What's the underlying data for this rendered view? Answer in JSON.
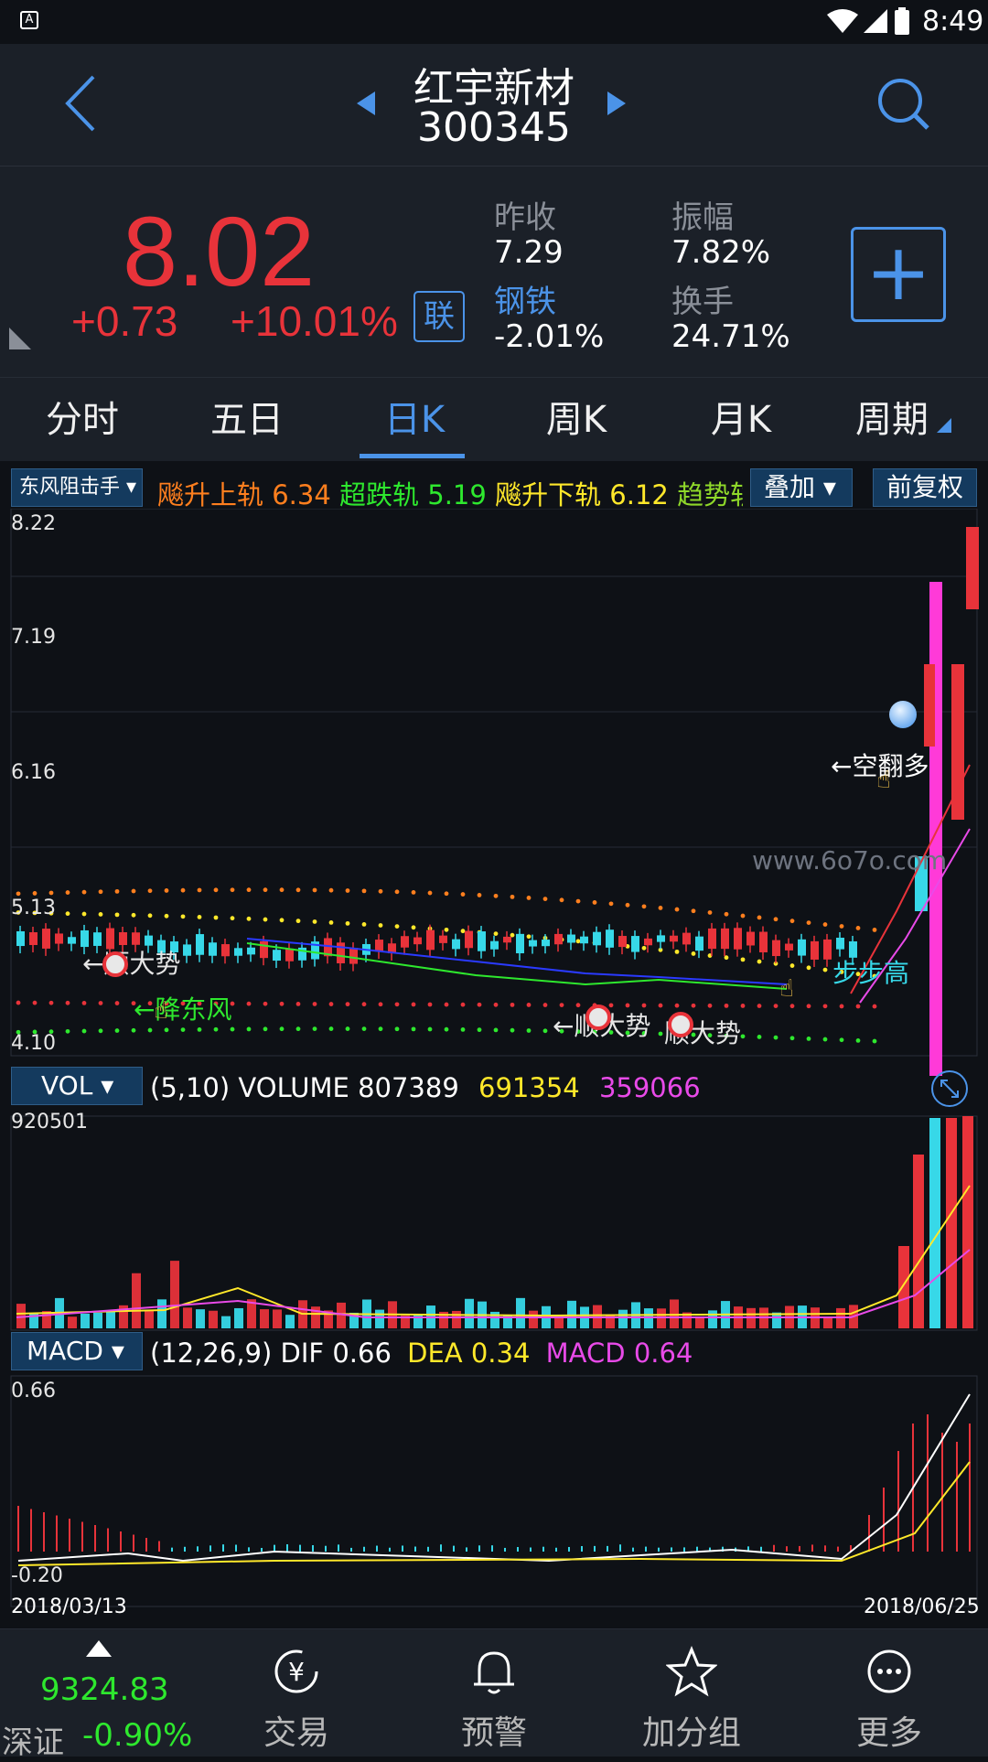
{
  "status_bar": {
    "time": "8:49"
  },
  "header": {
    "stock_name": "红宇新材",
    "stock_code": "300345"
  },
  "quote": {
    "price": "8.02",
    "change": "+0.73",
    "change_pct": "+10.01%",
    "link_label": "联",
    "prev_close_label": "昨收",
    "prev_close": "7.29",
    "sector_label": "钢铁",
    "sector_change": "-2.01%",
    "amplitude_label": "振幅",
    "amplitude": "7.82%",
    "turnover_label": "换手",
    "turnover": "24.71%",
    "add_label": "+"
  },
  "tabs": [
    {
      "label": "分时"
    },
    {
      "label": "五日"
    },
    {
      "label": "日K",
      "active": true
    },
    {
      "label": "周K"
    },
    {
      "label": "月K"
    },
    {
      "label": "周期"
    }
  ],
  "main_indicator": {
    "selector": "东风阻击手",
    "items": [
      {
        "label": "飚升上轨",
        "value": "6.34",
        "color": "#ff7f1e"
      },
      {
        "label": "超跌轨",
        "value": "5.19",
        "color": "#2ee82e"
      },
      {
        "label": "飚升下轨",
        "value": "6.12",
        "color": "#ffe82a"
      },
      {
        "label": "趋势轨",
        "value": "",
        "color": "#8fd82a"
      }
    ],
    "overlay_button": "叠加",
    "adjust_button": "前复权"
  },
  "price_axis": {
    "labels": [
      "8.22",
      "7.19",
      "6.16",
      "5.13",
      "4.10"
    ]
  },
  "annotations": [
    "←顺大势",
    "←降东风",
    "←顺大势",
    "顺大势",
    "←空翻多",
    "步步高"
  ],
  "watermark": "www.6o7o.com",
  "volume_panel": {
    "selector": "VOL",
    "params": "(5,10) VOLUME",
    "volume": "807389",
    "ma5": "691354",
    "ma10": "359066",
    "max_label": "920501"
  },
  "macd_panel": {
    "selector": "MACD",
    "params": "(12,26,9)",
    "dif_label": "DIF",
    "dif": "0.66",
    "dea_label": "DEA",
    "dea": "0.34",
    "macd_label": "MACD",
    "macd": "0.64",
    "max_label": "0.66",
    "min_label": "-0.20"
  },
  "date_range": {
    "start": "2018/03/13",
    "end": "2018/06/25"
  },
  "bottom_nav": {
    "index_value": "9324.83",
    "index_name": "深证",
    "index_change": "-0.90%",
    "items": [
      {
        "label": "交易"
      },
      {
        "label": "预警"
      },
      {
        "label": "加分组"
      },
      {
        "label": "更多"
      }
    ]
  },
  "colors": {
    "up": "#e8333a",
    "down": "#37d8e8",
    "accent": "#4b93e8",
    "background": "#0e1116",
    "panel": "#1b2028"
  }
}
